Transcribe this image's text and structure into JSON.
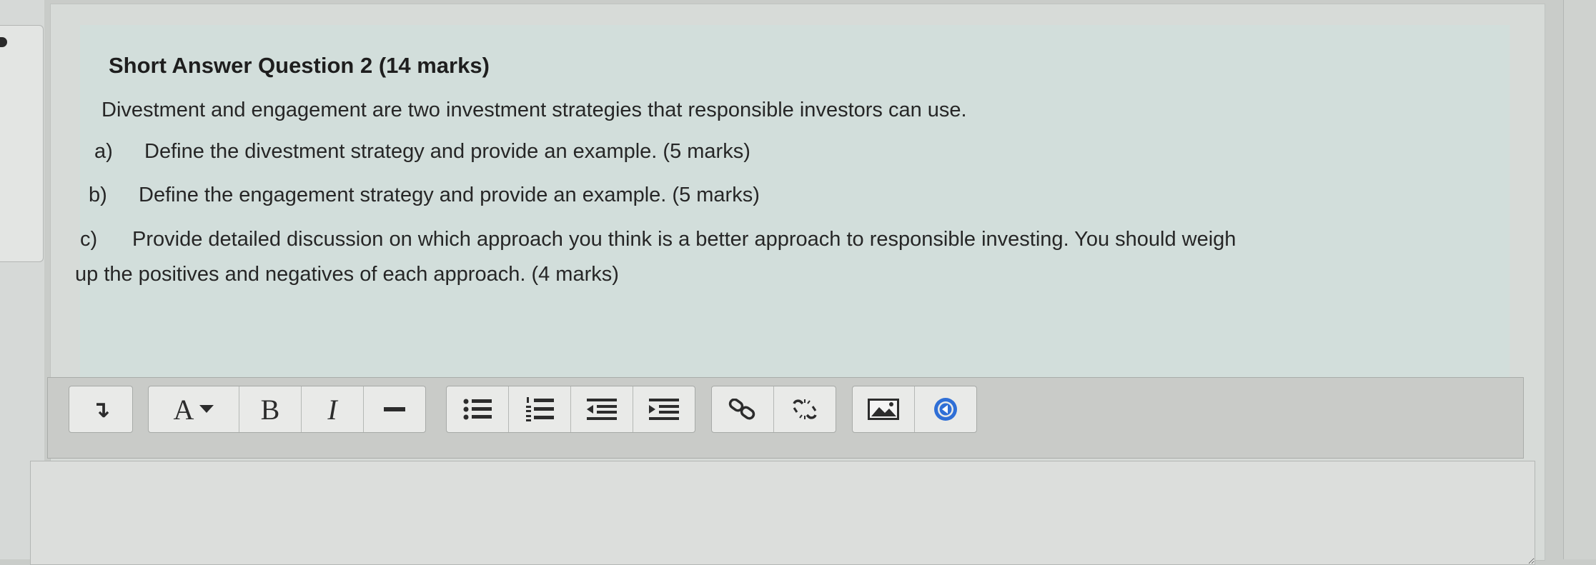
{
  "question": {
    "title_bold": "Short Answer",
    "title_rest": "Question 2 (14 marks)",
    "intro": "Divestment and engagement are two investment strategies that responsible investors can use.",
    "parts": [
      {
        "label": "a)",
        "text": "Define the divestment strategy and provide an example. (5 marks)"
      },
      {
        "label": "b)",
        "text": "Define the engagement strategy and provide an example. (5 marks)"
      },
      {
        "label": "c)",
        "text": "Provide detailed discussion on which approach you think is a better approach to responsible investing. You should weigh",
        "continuation": "up the positives and negatives of each approach. (4 marks)"
      }
    ]
  },
  "toolbar": {
    "paragraph_icon": "↴",
    "font_label": "A",
    "bold_label": "B",
    "italic_label": "I",
    "icons": [
      "paragraph-format-icon",
      "font-style-icon",
      "bold-icon",
      "italic-icon",
      "horizontal-rule-icon",
      "bullet-list-icon",
      "numbered-list-icon",
      "outdent-icon",
      "indent-icon",
      "link-icon",
      "unlink-icon",
      "image-icon",
      "media-icon"
    ]
  },
  "answer": {
    "value": ""
  },
  "colors": {
    "panel": "#d2dedb",
    "toolbar": "#c9cbc8",
    "button": "#e9eae8",
    "accent": "#2f6fd6"
  }
}
